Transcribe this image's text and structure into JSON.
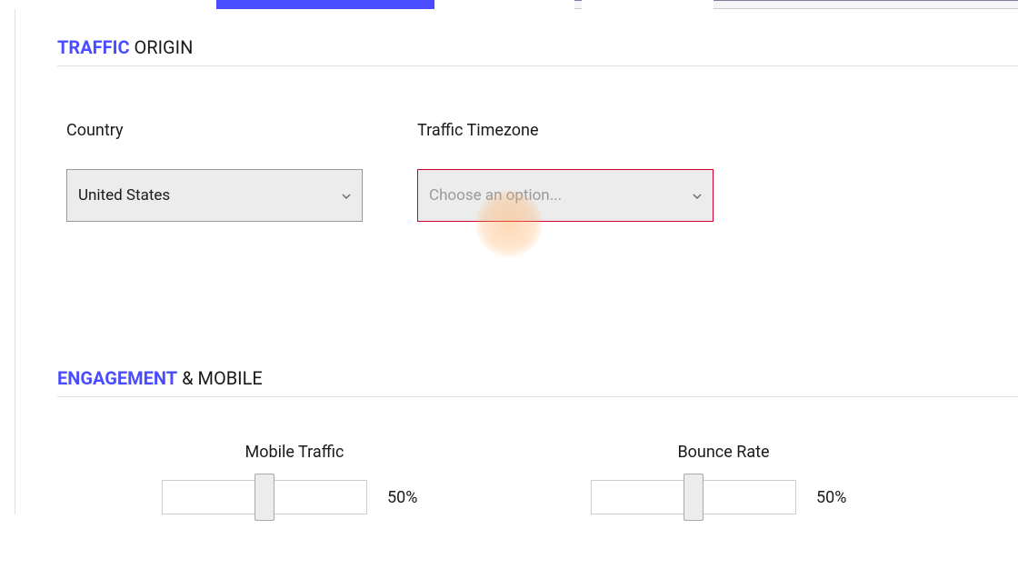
{
  "sections": {
    "traffic_origin": {
      "header_highlight": "TRAFFIC",
      "header_rest": " ORIGIN"
    },
    "engagement": {
      "header_highlight": "ENGAGEMENT",
      "header_rest": " & MOBILE"
    }
  },
  "fields": {
    "country": {
      "label": "Country",
      "value": "United States"
    },
    "timezone": {
      "label": "Traffic Timezone",
      "placeholder": "Choose an option..."
    }
  },
  "sliders": {
    "mobile": {
      "label": "Mobile Traffic",
      "value": "50%"
    },
    "bounce": {
      "label": "Bounce Rate",
      "value": "50%"
    }
  }
}
